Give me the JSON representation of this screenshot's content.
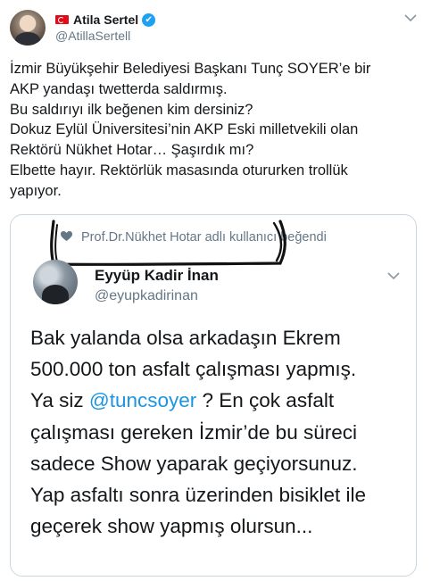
{
  "author": {
    "display_name": "Atila Sertel",
    "handle": "@AtillaSertell",
    "verified_mark": "✔"
  },
  "tweet_lines": [
    "İzmir Büyükşehir Belediyesi Başkanı Tunç SOYER’e bir",
    "AKP yandaşı twetterda saldırmış.",
    "Bu saldırıyı ilk beğenen kim dersiniz?",
    "Dokuz Eylül Üniversitesi’nin AKP Eski milletvekili olan",
    "Rektörü Nükhet Hotar… Şaşırdık mı?",
    "Elbette hayır. Rektörlük masasında otururken trollük",
    "yapıyor."
  ],
  "embedded": {
    "liked_by": "Prof.Dr.Nükhet Hotar adlı kullanıcı beğendi",
    "name": "Eyyüp Kadir İnan",
    "handle": "@eyupkadirinan",
    "lines": {
      "l1": "Bak yalanda olsa arkadaşın Ekrem",
      "l2": "500.000 ton asfalt çalışması yapmış.",
      "l3_pre": "Ya siz ",
      "l3_mention": "@tuncsoyer",
      "l3_post": " ? En çok asfalt",
      "l4": "çalışması gereken İzmir’de bu süreci",
      "l5": "sadece Show yaparak geçiyorsunuz.",
      "l6": "Yap asfaltı sonra üzerinden bisiklet ile",
      "l7": "geçerek show yapmış olursun..."
    }
  },
  "icons": {
    "menu_chevron": "chevron-down-icon",
    "heart": "heart-icon",
    "verified": "verified-badge-icon",
    "flag": "turkey-flag-icon"
  },
  "colors": {
    "link": "#1b95e0",
    "verified": "#1da1f2",
    "muted": "#657786",
    "border": "#ccd6dd"
  }
}
